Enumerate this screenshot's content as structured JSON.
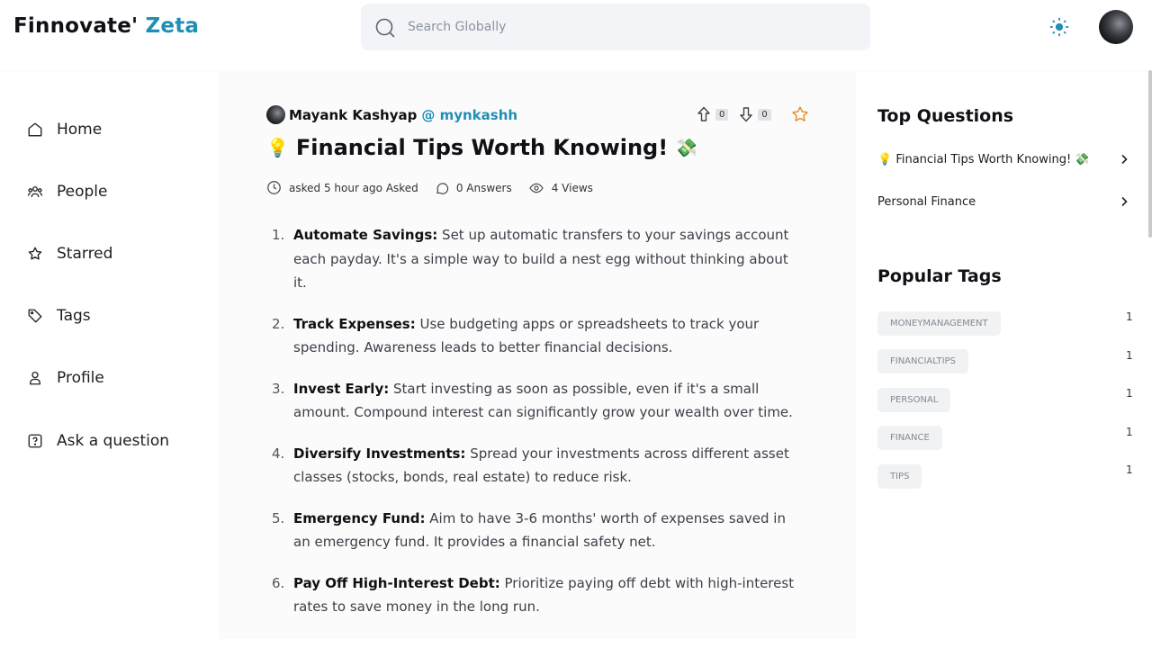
{
  "brand": {
    "name": "Finnovate'",
    "accent": "Zeta",
    "accent_color": "#1f8fb5"
  },
  "search": {
    "placeholder": "Search Globally",
    "value": ""
  },
  "header_icons": [
    "sun-icon",
    "avatar"
  ],
  "sidebar": {
    "items": [
      {
        "label": "Home",
        "icon": "home-icon"
      },
      {
        "label": "People",
        "icon": "people-icon"
      },
      {
        "label": "Starred",
        "icon": "star-icon"
      },
      {
        "label": "Tags",
        "icon": "tag-icon"
      },
      {
        "label": "Profile",
        "icon": "user-icon"
      },
      {
        "label": "Ask a question",
        "icon": "question-icon"
      }
    ]
  },
  "question": {
    "author_name": "Mayank Kashyap",
    "author_handle": "@ mynkashh",
    "upvotes": "0",
    "downvotes": "0",
    "title_emoji_left": "💡",
    "title": "Financial Tips Worth Knowing!",
    "title_emoji_right": "💸",
    "asked": "asked 5 hour ago Asked",
    "answers": "0 Answers",
    "views": "4 Views",
    "tips": [
      {
        "num": "1.",
        "title": "Automate Savings:",
        "text": " Set up automatic transfers to your savings account each payday. It's a simple way to build a nest egg without thinking about it."
      },
      {
        "num": "2.",
        "title": "Track Expenses:",
        "text": " Use budgeting apps or spreadsheets to track your spending. Awareness leads to better financial decisions."
      },
      {
        "num": "3.",
        "title": "Invest Early:",
        "text": " Start investing as soon as possible, even if it's a small amount. Compound interest can significantly grow your wealth over time."
      },
      {
        "num": "4.",
        "title": "Diversify Investments:",
        "text": " Spread your investments across different asset classes (stocks, bonds, real estate) to reduce risk."
      },
      {
        "num": "5.",
        "title": "Emergency Fund:",
        "text": " Aim to have 3-6 months' worth of expenses saved in an emergency fund. It provides a financial safety net."
      },
      {
        "num": "6.",
        "title": "Pay Off High-Interest Debt:",
        "text": " Prioritize paying off debt with high-interest rates to save money in the long run."
      }
    ]
  },
  "right": {
    "top_questions_title": "Top Questions",
    "top_questions": [
      {
        "label": "💡 Financial Tips Worth Knowing! 💸"
      },
      {
        "label": "Personal Finance"
      }
    ],
    "popular_tags_title": "Popular Tags",
    "tags": [
      {
        "name": "MONEYMANAGEMENT",
        "count": "1"
      },
      {
        "name": "FINANCIALTIPS",
        "count": "1"
      },
      {
        "name": "PERSONAL",
        "count": "1"
      },
      {
        "name": "FINANCE",
        "count": "1"
      },
      {
        "name": "TIPS",
        "count": "1"
      }
    ]
  }
}
